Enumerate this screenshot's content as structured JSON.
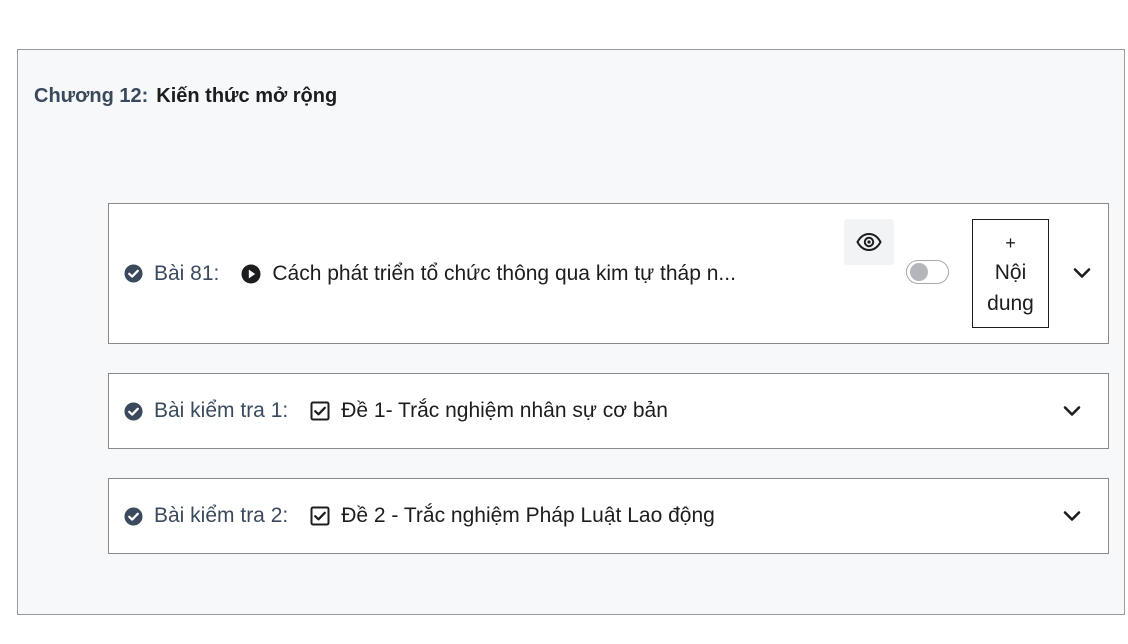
{
  "chapter": {
    "prefix": "Chương 12:",
    "name": "Kiến thức mở rộng"
  },
  "lessons": [
    {
      "number_label": "Bài 81:",
      "type_icon": "play-circle-icon",
      "title": "Cách phát triển tổ chức thông qua kim tự tháp n...",
      "completed": true,
      "visibility_toggle_on": false,
      "add_content_label": [
        "+",
        "Nội",
        "dung"
      ]
    },
    {
      "number_label": "Bài kiểm tra 1:",
      "type_icon": "checkbox-icon",
      "title": "Đề 1- Trắc nghiệm nhân sự cơ bản",
      "completed": true
    },
    {
      "number_label": "Bài kiểm tra 2:",
      "type_icon": "checkbox-icon",
      "title": "Đề 2 - Trắc nghiệm Pháp Luật Lao động",
      "completed": true
    }
  ],
  "colors": {
    "accent": "#3a4a5c",
    "text": "#1c1d1f",
    "panel_bg": "#f7f8fa",
    "toggle_off": "#b3b6ba"
  }
}
